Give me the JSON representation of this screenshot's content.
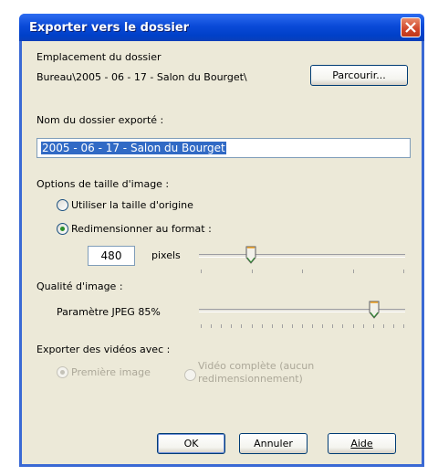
{
  "window": {
    "title": "Exporter vers le dossier"
  },
  "folder_location": {
    "label": "Emplacement du dossier",
    "path": "Bureau\\2005 - 06 - 17 - Salon du Bourget\\",
    "browse_button": "Parcourir..."
  },
  "export_name": {
    "label": "Nom du dossier exporté :",
    "value": "2005 - 06 - 17 - Salon du Bourget"
  },
  "size_options": {
    "label": "Options de taille d'image :",
    "options": [
      "Utiliser la taille d'origine",
      "Redimensionner au format :"
    ],
    "selected": 1,
    "size_value": "480",
    "size_unit": "pixels",
    "slider_fraction": 0.25
  },
  "quality": {
    "label": "Qualité d'image :",
    "setting_text": "Paramètre JPEG 85%",
    "slider_value": 85
  },
  "videos": {
    "label": "Exporter des vidéos avec :",
    "options": [
      "Première image",
      "Vidéo complète (aucun",
      "redimensionnement)"
    ],
    "selected": 0,
    "disabled": true
  },
  "buttons": {
    "ok": "OK",
    "cancel": "Annuler",
    "help": "Aide"
  },
  "colors": {
    "title_bar": "#0a4ad8",
    "frame": "#3a69d4",
    "dialog_bg": "#ece9d8",
    "selection": "#316ac5",
    "radio_dot": "#2a8e2a",
    "close_button": "#d0462a"
  },
  "icons": {
    "close": "close-x-icon",
    "slider_thumb": "slider-thumb-icon"
  }
}
